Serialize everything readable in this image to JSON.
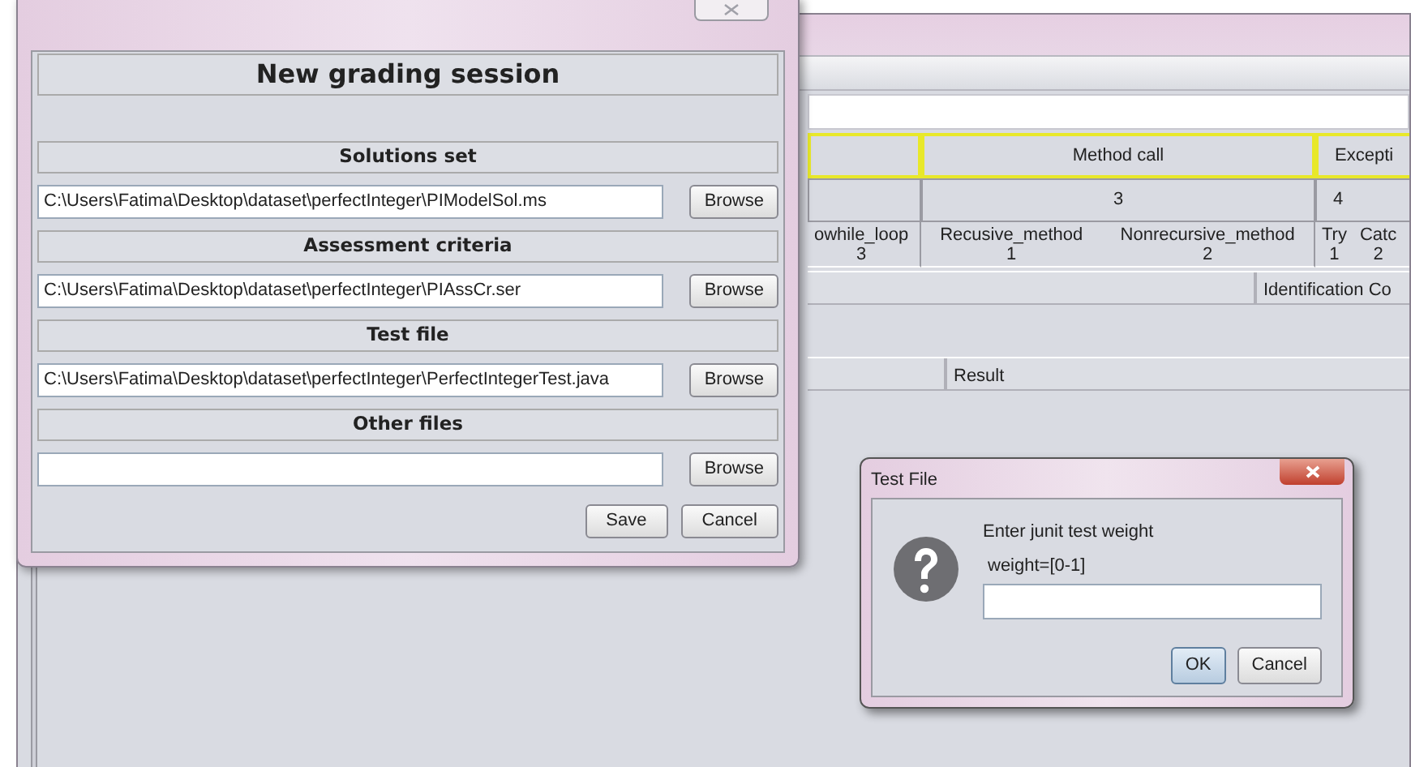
{
  "main_window": {
    "criteria_table": {
      "groups": [
        {
          "items": [
            {
              "name": "owhile_loop",
              "value": "3"
            }
          ]
        },
        {
          "title": "Method call",
          "count": "3",
          "items": [
            {
              "name": "Recusive_method",
              "value": "1"
            },
            {
              "name": "Nonrecursive_method",
              "value": "2"
            }
          ]
        },
        {
          "title": "Excepti",
          "count": "4",
          "items": [
            {
              "name": "Try",
              "value": "1"
            },
            {
              "name": "Catc",
              "value": "2"
            }
          ]
        }
      ]
    },
    "identification_header": "Identification Co",
    "results_header": "Result"
  },
  "grading_dialog": {
    "title": "New grading session",
    "sections": [
      {
        "label": "Solutions set",
        "path": "C:\\Users\\Fatima\\Desktop\\dataset\\perfectInteger\\PIModelSol.ms",
        "button": "Browse"
      },
      {
        "label": "Assessment criteria",
        "path": "C:\\Users\\Fatima\\Desktop\\dataset\\perfectInteger\\PIAssCr.ser",
        "button": "Browse"
      },
      {
        "label": "Test file",
        "path": "C:\\Users\\Fatima\\Desktop\\dataset\\perfectInteger\\PerfectIntegerTest.java",
        "button": "Browse"
      },
      {
        "label": "Other files",
        "button": "Browse"
      }
    ],
    "buttons": [
      "Save",
      "Cancel"
    ]
  },
  "test_file_dialog": {
    "title": "Test File",
    "message": "Enter junit test weight",
    "hint": "weight=[0-1]",
    "buttons": [
      {
        "label": "OK",
        "default": true
      },
      {
        "label": "Cancel",
        "default": false
      }
    ]
  }
}
